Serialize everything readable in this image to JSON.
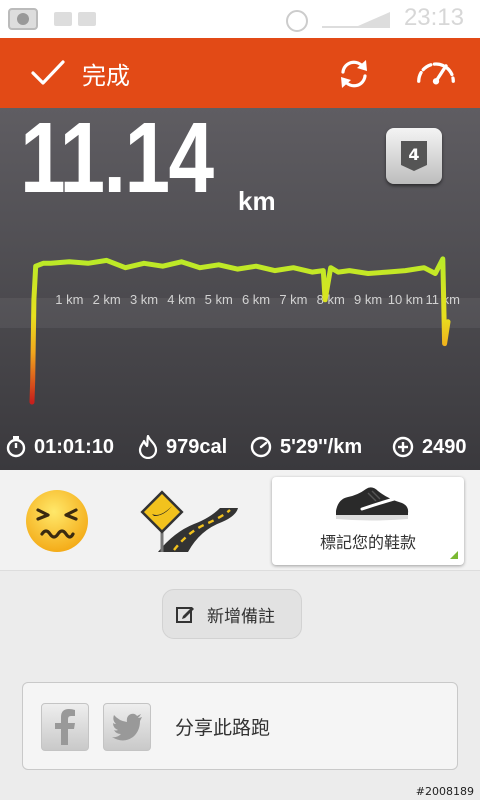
{
  "status_bar": {
    "time": "23:13"
  },
  "header": {
    "done_label": "完成",
    "icons": [
      "checkmark-icon",
      "sync-icon",
      "speedometer-icon"
    ]
  },
  "run": {
    "distance": "11.14",
    "unit": "km",
    "level": "4",
    "km_labels": [
      "1 km",
      "2 km",
      "3 km",
      "4 km",
      "5 km",
      "6 km",
      "7 km",
      "8 km",
      "9 km",
      "10 km",
      "11 km"
    ]
  },
  "stats": {
    "duration": "01:01:10",
    "calories": "979cal",
    "pace": "5'29''/km",
    "fuel": "2490"
  },
  "shoe": {
    "label": "標記您的鞋款"
  },
  "note": {
    "label": "新增備註"
  },
  "share": {
    "label": "分享此路跑"
  },
  "watermark": "#2008189",
  "chart_data": {
    "type": "line",
    "x": [
      0,
      0.02,
      0.05,
      0.1,
      0.3,
      0.5,
      1.0,
      1.5,
      2.0,
      2.5,
      3.0,
      3.5,
      4.0,
      4.5,
      5.0,
      5.5,
      6.0,
      6.5,
      7.0,
      7.5,
      7.8,
      7.85,
      8.0,
      8.2,
      8.5,
      9.0,
      9.5,
      10.0,
      10.5,
      10.8,
      11.0,
      11.05,
      11.14
    ],
    "values": [
      0.0,
      0.15,
      0.7,
      0.93,
      0.95,
      0.95,
      0.96,
      0.95,
      0.97,
      0.92,
      0.95,
      0.93,
      0.96,
      0.92,
      0.94,
      0.91,
      0.93,
      0.9,
      0.92,
      0.89,
      0.9,
      0.7,
      0.92,
      0.89,
      0.9,
      0.88,
      0.89,
      0.9,
      0.92,
      0.88,
      0.98,
      0.4,
      0.55
    ],
    "xlim": [
      0,
      11.14
    ],
    "xlabel": "",
    "ylabel": "",
    "grid": true,
    "colors": {
      "slow": "#c8201c",
      "mid": "#f2c21d",
      "fast": "#b9ea28"
    }
  }
}
